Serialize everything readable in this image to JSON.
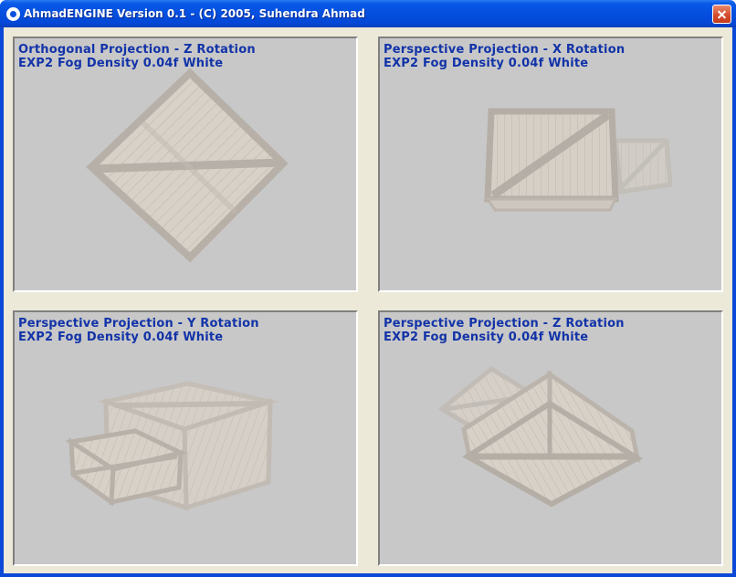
{
  "window": {
    "title": "AhmadENGINE Version 0.1 - (C) 2005, Suhendra Ahmad"
  },
  "viewports": [
    {
      "title": "Orthogonal Projection - Z Rotation",
      "subtitle": "EXP2 Fog Density 0.04f White"
    },
    {
      "title": "Perspective Projection - X Rotation",
      "subtitle": "EXP2 Fog Density 0.04f White"
    },
    {
      "title": "Perspective Projection - Y Rotation",
      "subtitle": "EXP2 Fog Density 0.04f White"
    },
    {
      "title": "Perspective Projection - Z Rotation",
      "subtitle": "EXP2 Fog Density 0.04f White"
    }
  ],
  "colors": {
    "title_bar": "#0550e0",
    "client_background": "#ece9d8",
    "viewport_background": "#c8c8c8",
    "label_text": "#1233a8",
    "crate_wood": "#d7d0c6",
    "crate_frame": "#b2aba3"
  }
}
